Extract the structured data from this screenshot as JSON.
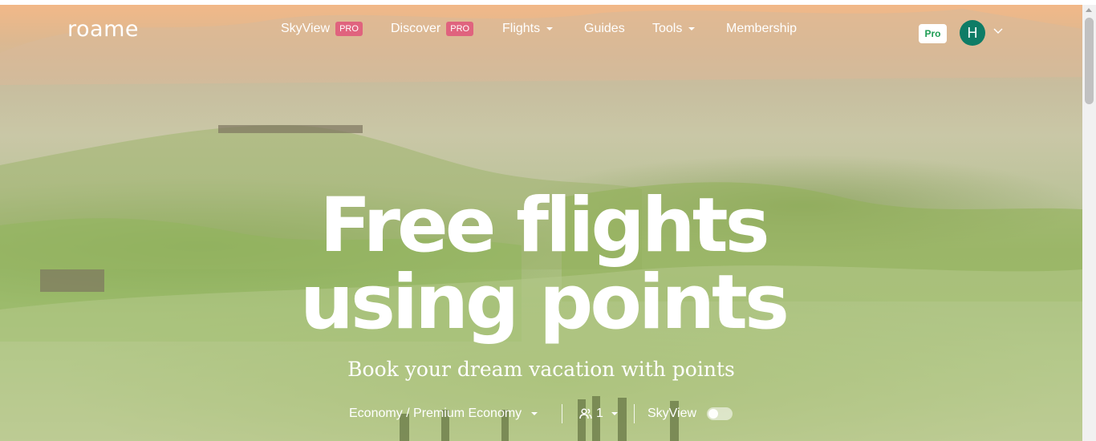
{
  "brand": {
    "logo_text": "roame"
  },
  "nav": {
    "items": [
      {
        "label": "SkyView",
        "badge": "PRO"
      },
      {
        "label": "Discover",
        "badge": "PRO"
      },
      {
        "label": "Flights"
      },
      {
        "label": "Guides"
      },
      {
        "label": "Tools"
      },
      {
        "label": "Membership"
      }
    ]
  },
  "account": {
    "plan_badge": "Pro",
    "avatar_initial": "H"
  },
  "hero": {
    "headline_line1": "Free flights",
    "headline_line2": "using points",
    "subtitle": "Book your dream vacation with points"
  },
  "search": {
    "cabin_class": "Economy / Premium Economy",
    "passengers": "1",
    "skyview_label": "SkyView",
    "skyview_enabled": false
  },
  "colors": {
    "pro_badge": "#e0637e",
    "avatar_bg": "#0e7c66",
    "plan_badge_text": "#1f9d55"
  },
  "icons": [
    "chevron-down-icon",
    "users-icon",
    "toggle-switch"
  ]
}
